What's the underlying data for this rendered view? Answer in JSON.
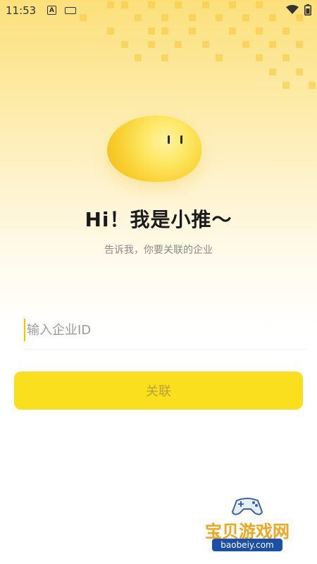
{
  "status_bar": {
    "time": "11:53",
    "icons": [
      "a-icon",
      "keyboard-icon",
      "wifi-icon",
      "battery-icon"
    ]
  },
  "mascot": {
    "name": "mascot-blob"
  },
  "greeting": {
    "headline": "Hi！我是小推～",
    "subtitle": "告诉我，你要关联的企业"
  },
  "form": {
    "enterprise_id_placeholder": "输入企业ID",
    "enterprise_id_value": "",
    "submit_label": "关联"
  },
  "watermark": {
    "name": "宝贝游戏网",
    "url": "baobeiy.com"
  },
  "colors": {
    "accent": "#f9df1e",
    "background_top": "#fbe07a",
    "button_text": "#b9a23a"
  }
}
